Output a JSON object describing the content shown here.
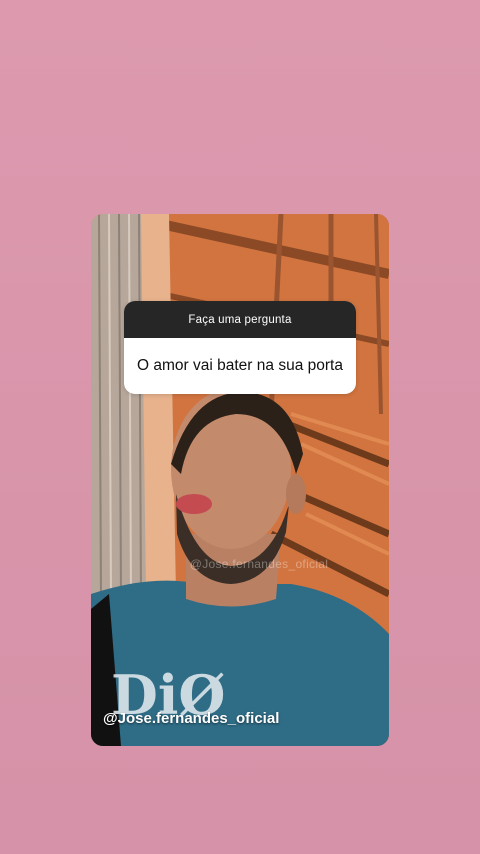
{
  "question_box": {
    "prompt": "Faça uma pergunta",
    "answer": "O amor vai bater na sua porta"
  },
  "watermark": {
    "handle": "@Jose.fernandes_oficial",
    "faint_handle": "@Jose.fernandes_oficial"
  },
  "colors": {
    "page_background": "#dd9aaf",
    "question_header": "#262626",
    "question_body": "#ffffff",
    "shirt": "#2f6c86"
  }
}
